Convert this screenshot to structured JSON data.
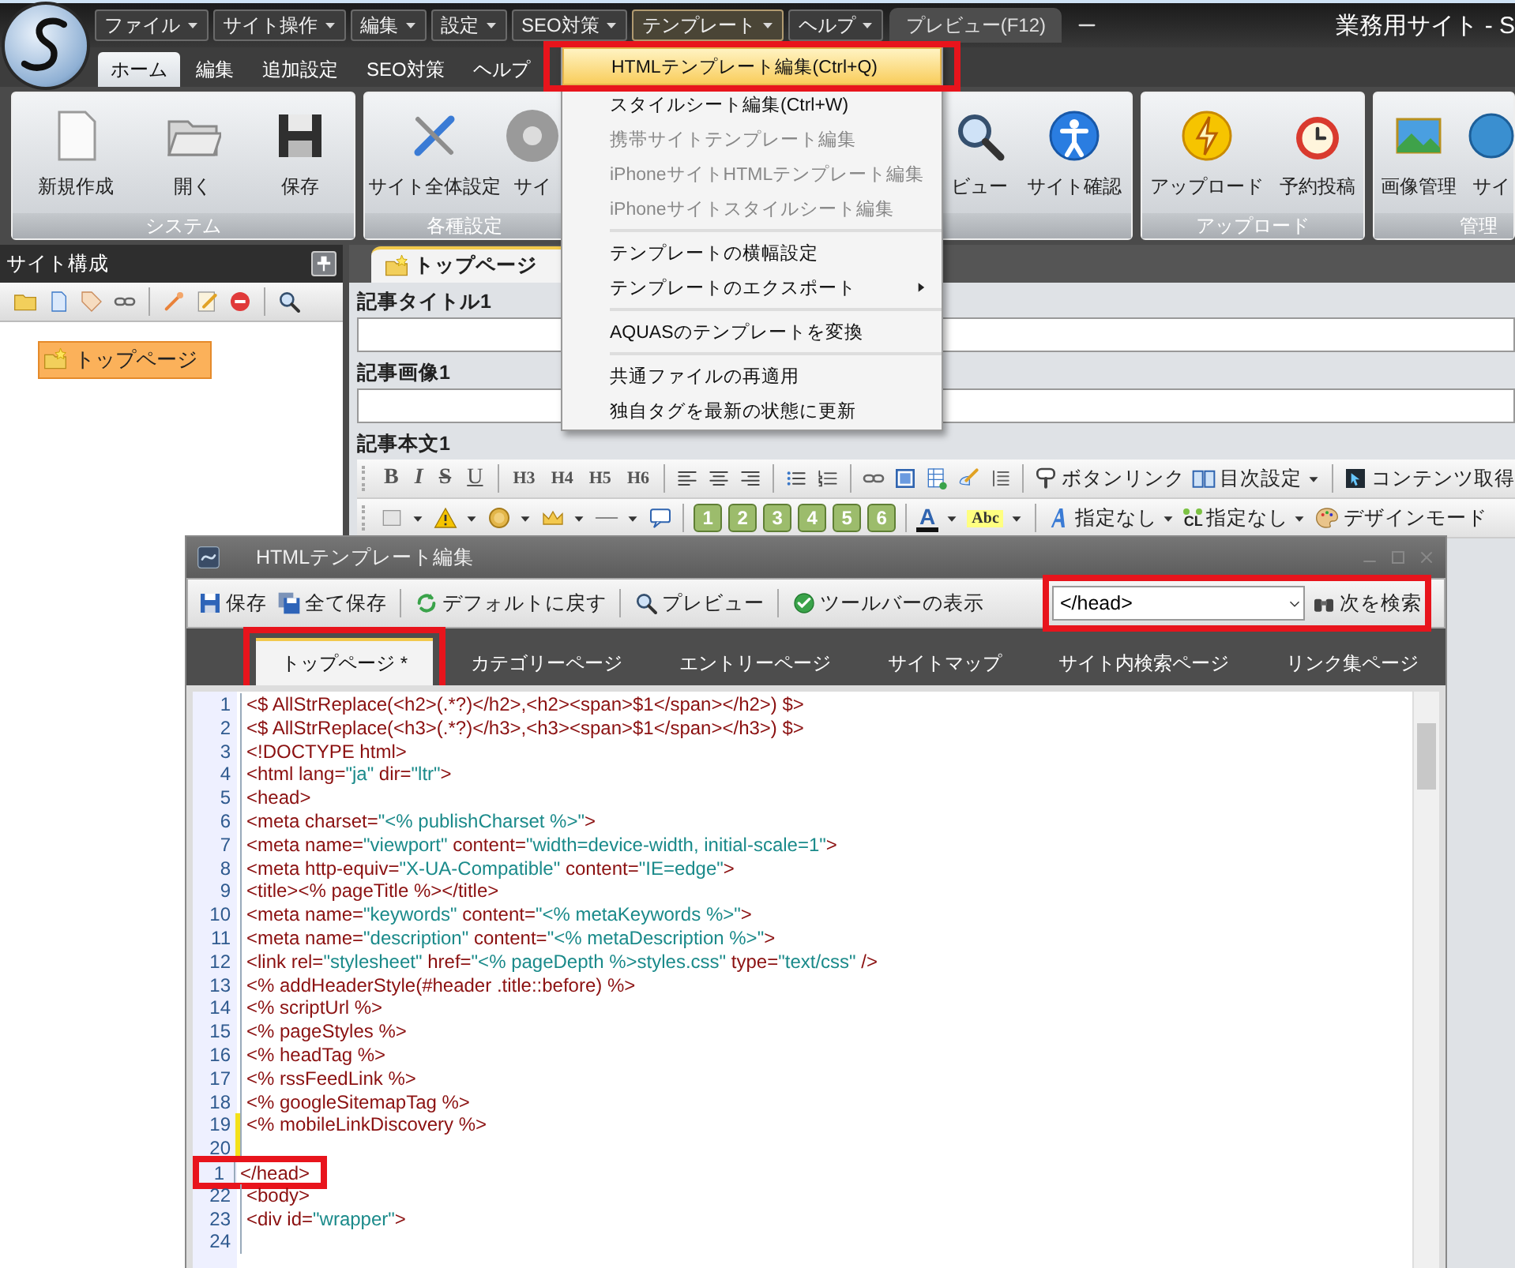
{
  "app": {
    "title": "業務用サイト - S"
  },
  "menubar": [
    {
      "label": "ファイル",
      "open": false
    },
    {
      "label": "サイト操作",
      "open": false
    },
    {
      "label": "編集",
      "open": false
    },
    {
      "label": "設定",
      "open": false
    },
    {
      "label": "SEO対策",
      "open": false
    },
    {
      "label": "テンプレート",
      "open": true
    },
    {
      "label": "ヘルプ",
      "open": false
    }
  ],
  "preview_tab": {
    "label": "プレビュー(F12)"
  },
  "ribbon_tabs": [
    {
      "label": "ホーム",
      "selected": true
    },
    {
      "label": "編集",
      "selected": false
    },
    {
      "label": "追加設定",
      "selected": false
    },
    {
      "label": "SEO対策",
      "selected": false
    },
    {
      "label": "ヘルプ",
      "selected": false
    }
  ],
  "ribbon_groups": [
    {
      "label": "システム",
      "buttons": [
        "新規作成",
        "開く",
        "保存"
      ]
    },
    {
      "label": "各種設定",
      "buttons": [
        "サイト全体設定",
        "サイ"
      ]
    },
    {
      "buttons": [
        "ビュー",
        "サイト確認"
      ]
    },
    {
      "label": "アップロード",
      "buttons": [
        "アップロード",
        "予約投稿"
      ]
    },
    {
      "label": "管理",
      "buttons": [
        "画像管理",
        "サイ"
      ]
    }
  ],
  "template_menu": [
    {
      "kind": "item",
      "label": "HTMLテンプレート編集(Ctrl+Q)",
      "disabled": false,
      "selected": true,
      "annotated": true,
      "submenu": false
    },
    {
      "kind": "item",
      "label": "スタイルシート編集(Ctrl+W)",
      "disabled": false,
      "selected": false,
      "annotated": false,
      "submenu": false
    },
    {
      "kind": "item",
      "label": "携帯サイトテンプレート編集",
      "disabled": true,
      "selected": false,
      "annotated": false,
      "submenu": false
    },
    {
      "kind": "item",
      "label": "iPhoneサイトHTMLテンプレート編集",
      "disabled": true,
      "selected": false,
      "annotated": false,
      "submenu": false
    },
    {
      "kind": "item",
      "label": "iPhoneサイトスタイルシート編集",
      "disabled": true,
      "selected": false,
      "annotated": false,
      "submenu": false
    },
    {
      "kind": "separator"
    },
    {
      "kind": "item",
      "label": "テンプレートの横幅設定",
      "disabled": false,
      "selected": false,
      "annotated": false,
      "submenu": false
    },
    {
      "kind": "item",
      "label": "テンプレートのエクスポート",
      "disabled": false,
      "selected": false,
      "annotated": false,
      "submenu": true
    },
    {
      "kind": "separator"
    },
    {
      "kind": "item",
      "label": "AQUASのテンプレートを変換",
      "disabled": false,
      "selected": false,
      "annotated": false,
      "submenu": false
    },
    {
      "kind": "separator"
    },
    {
      "kind": "item",
      "label": "共通ファイルの再適用",
      "disabled": false,
      "selected": false,
      "annotated": false,
      "submenu": false
    },
    {
      "kind": "item",
      "label": "独自タグを最新の状態に更新",
      "disabled": false,
      "selected": false,
      "annotated": false,
      "submenu": false
    }
  ],
  "site_panel": {
    "title": "サイト構成",
    "tree": [
      {
        "label": "トップページ",
        "selected": true
      }
    ]
  },
  "document": {
    "tab": "トップページ",
    "fields": [
      "記事タイトル1",
      "記事画像1"
    ],
    "body_label": "記事本文1"
  },
  "format_bar": [
    {
      "kind": "glyph",
      "label": "B"
    },
    {
      "kind": "glyph",
      "label": "I"
    },
    {
      "kind": "glyph",
      "label": "S"
    },
    {
      "kind": "glyph",
      "label": "U"
    },
    {
      "kind": "sep"
    },
    {
      "kind": "heading",
      "label": "H3"
    },
    {
      "kind": "heading",
      "label": "H4"
    },
    {
      "kind": "heading",
      "label": "H5"
    },
    {
      "kind": "heading",
      "label": "H6"
    },
    {
      "kind": "sep"
    },
    {
      "kind": "icon",
      "dropdown": false
    },
    {
      "kind": "icon",
      "dropdown": false
    },
    {
      "kind": "icon",
      "dropdown": false
    },
    {
      "kind": "sep"
    },
    {
      "kind": "icon",
      "dropdown": false
    },
    {
      "kind": "icon",
      "dropdown": false
    },
    {
      "kind": "sep"
    },
    {
      "kind": "icon",
      "dropdown": false
    },
    {
      "kind": "icon",
      "dropdown": false
    },
    {
      "kind": "icon",
      "dropdown": false
    },
    {
      "kind": "icon",
      "dropdown": false
    },
    {
      "kind": "icon",
      "dropdown": false
    },
    {
      "kind": "sep"
    },
    {
      "kind": "labeled",
      "label": "ボタンリンク",
      "dropdown": false
    },
    {
      "kind": "labeled",
      "label": "目次設定",
      "dropdown": true
    },
    {
      "kind": "sep"
    },
    {
      "kind": "labeled",
      "label": "コンテンツ取得",
      "dropdown": false
    }
  ],
  "insert_bar": [
    {
      "kind": "icon",
      "dropdown": true
    },
    {
      "kind": "icon",
      "dropdown": true
    },
    {
      "kind": "icon",
      "dropdown": true
    },
    {
      "kind": "icon",
      "dropdown": true
    },
    {
      "kind": "icon",
      "dropdown": true
    },
    {
      "kind": "icon",
      "dropdown": false
    },
    {
      "kind": "sep"
    },
    {
      "kind": "number",
      "label": "1"
    },
    {
      "kind": "number",
      "label": "2"
    },
    {
      "kind": "number",
      "label": "3"
    },
    {
      "kind": "number",
      "label": "4"
    },
    {
      "kind": "number",
      "label": "5"
    },
    {
      "kind": "number",
      "label": "6"
    },
    {
      "kind": "sep"
    },
    {
      "kind": "font-color",
      "label": "A",
      "dropdown": true
    },
    {
      "kind": "highlight",
      "label": "Abc",
      "dropdown": true
    },
    {
      "kind": "sep"
    },
    {
      "kind": "labeled",
      "label": "指定なし",
      "dropdown": true
    },
    {
      "kind": "labeled",
      "badge": "CL",
      "label": "指定なし",
      "dropdown": true
    },
    {
      "kind": "labeled",
      "label": "デザインモード",
      "dropdown": false
    }
  ],
  "template_window": {
    "title": "HTMLテンプレート編集",
    "toolbar": [
      "保存",
      "全て保存",
      "デフォルトに戻す",
      "プレビュー",
      "ツールバーの表示"
    ],
    "search": {
      "value": "</head>",
      "annotated": true
    },
    "find_button": "次を検索",
    "tabs": [
      {
        "label": "トップページ *",
        "selected": true,
        "annotated": true
      },
      {
        "label": "カテゴリーページ",
        "selected": false,
        "annotated": false
      },
      {
        "label": "エントリーページ",
        "selected": false,
        "annotated": false
      },
      {
        "label": "サイトマップ",
        "selected": false,
        "annotated": false
      },
      {
        "label": "サイト内検索ページ",
        "selected": false,
        "annotated": false
      },
      {
        "label": "リンク集ページ",
        "selected": false,
        "annotated": false
      }
    ],
    "lines": [
      {
        "num": "1",
        "text": "<$ AllStrReplace(<h2>(.*?)</h2>,<h2><span>$1</span></h2>) $>",
        "changed": false,
        "annotated": false
      },
      {
        "num": "2",
        "text": "<$ AllStrReplace(<h3>(.*?)</h3>,<h3><span>$1</span></h3>) $>",
        "changed": false,
        "annotated": false
      },
      {
        "num": "3",
        "text": "<!DOCTYPE html>",
        "changed": false,
        "annotated": false
      },
      {
        "num": "4",
        "text": "<html lang=\"ja\" dir=\"ltr\">",
        "changed": false,
        "annotated": false
      },
      {
        "num": "5",
        "text": "<head>",
        "changed": false,
        "annotated": false
      },
      {
        "num": "6",
        "text": "<meta charset=\"<% publishCharset %>\">",
        "changed": false,
        "annotated": false
      },
      {
        "num": "7",
        "text": "<meta name=\"viewport\" content=\"width=device-width, initial-scale=1\">",
        "changed": false,
        "annotated": false
      },
      {
        "num": "8",
        "text": "<meta http-equiv=\"X-UA-Compatible\" content=\"IE=edge\">",
        "changed": false,
        "annotated": false
      },
      {
        "num": "9",
        "text": "<title><% pageTitle %></title>",
        "changed": false,
        "annotated": false
      },
      {
        "num": "10",
        "text": "<meta name=\"keywords\" content=\"<% metaKeywords %>\">",
        "changed": false,
        "annotated": false
      },
      {
        "num": "11",
        "text": "<meta name=\"description\" content=\"<% metaDescription %>\">",
        "changed": false,
        "annotated": false
      },
      {
        "num": "12",
        "text": "<link rel=\"stylesheet\" href=\"<% pageDepth %>styles.css\" type=\"text/css\" />",
        "changed": false,
        "annotated": false
      },
      {
        "num": "13",
        "text": "<% addHeaderStyle(#header .title::before) %>",
        "changed": false,
        "annotated": false
      },
      {
        "num": "14",
        "text": "<% scriptUrl %>",
        "changed": false,
        "annotated": false
      },
      {
        "num": "15",
        "text": "<% pageStyles %>",
        "changed": false,
        "annotated": false
      },
      {
        "num": "16",
        "text": "<% headTag %>",
        "changed": false,
        "annotated": false
      },
      {
        "num": "17",
        "text": "<% rssFeedLink %>",
        "changed": false,
        "annotated": false
      },
      {
        "num": "18",
        "text": "<% googleSitemapTag %>",
        "changed": false,
        "annotated": false
      },
      {
        "num": "19",
        "text": "<% mobileLinkDiscovery %>",
        "changed": true,
        "annotated": false
      },
      {
        "num": "20",
        "changed": true,
        "annotated": false
      },
      {
        "num": "1",
        "text": "</head>",
        "changed": false,
        "annotated": true
      },
      {
        "num": "22",
        "text": "<body>",
        "changed": false,
        "annotated": false
      },
      {
        "num": "23",
        "text": "<div id=\"wrapper\">",
        "changed": false,
        "annotated": false
      },
      {
        "num": "24",
        "changed": false,
        "annotated": false
      }
    ]
  }
}
